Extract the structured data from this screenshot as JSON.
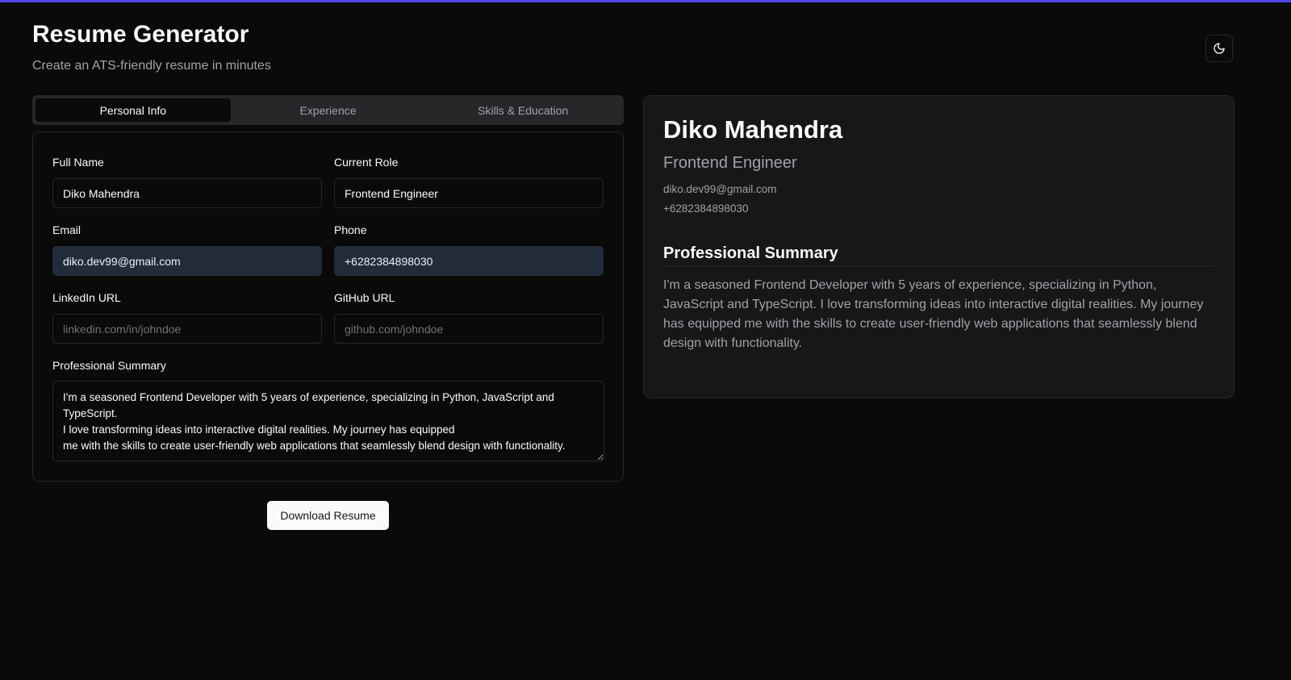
{
  "header": {
    "title": "Resume Generator",
    "subtitle": "Create an ATS-friendly resume in minutes",
    "theme_toggle_icon": "moon-icon"
  },
  "colors": {
    "background": "#0a0a0a",
    "accent_bar": "#4f46e5",
    "card_border": "#27272a",
    "preview_background": "#171717",
    "autofill_background": "#222c38"
  },
  "tabs": [
    {
      "label": "Personal Info",
      "active": true
    },
    {
      "label": "Experience",
      "active": false
    },
    {
      "label": "Skills & Education",
      "active": false
    }
  ],
  "form": {
    "full_name": {
      "label": "Full Name",
      "value": "Diko Mahendra"
    },
    "current_role": {
      "label": "Current Role",
      "value": "Frontend Engineer"
    },
    "email": {
      "label": "Email",
      "value": "diko.dev99@gmail.com"
    },
    "phone": {
      "label": "Phone",
      "value": "+6282384898030"
    },
    "linkedin": {
      "label": "LinkedIn URL",
      "value": "",
      "placeholder": "linkedin.com/in/johndoe"
    },
    "github": {
      "label": "GitHub URL",
      "value": "",
      "placeholder": "github.com/johndoe"
    },
    "summary": {
      "label": "Professional Summary",
      "value": "I'm a seasoned Frontend Developer with 5 years of experience, specializing in Python, JavaScript and TypeScript.\nI love transforming ideas into interactive digital realities. My journey has equipped\nme with the skills to create user-friendly web applications that seamlessly blend design with functionality."
    }
  },
  "download_button": "Download Resume",
  "preview": {
    "name": "Diko Mahendra",
    "role": "Frontend Engineer",
    "email": "diko.dev99@gmail.com",
    "phone": "+6282384898030",
    "section_title": "Professional Summary",
    "summary": "I'm a seasoned Frontend Developer with 5 years of experience, specializing in Python, JavaScript and TypeScript. I love transforming ideas into interactive digital realities. My journey has equipped me with the skills to create user-friendly web applications that seamlessly blend design with functionality."
  }
}
